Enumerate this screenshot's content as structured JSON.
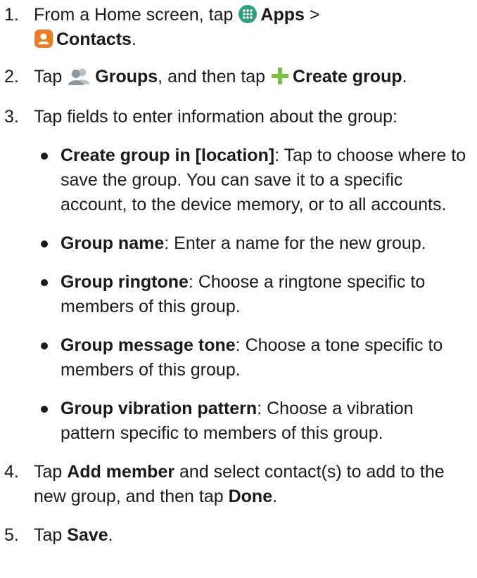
{
  "steps": [
    {
      "number": "1.",
      "before": "From a Home screen, tap ",
      "apps_label": "Apps",
      "separator": " >",
      "contacts_label": "Contacts",
      "after": "."
    },
    {
      "number": "2.",
      "before": "Tap ",
      "groups_label": "Groups",
      "middle": ", and then tap ",
      "create_label": "Create group",
      "after": "."
    },
    {
      "number": "3.",
      "text": "Tap fields to enter information about the group:",
      "fields": [
        {
          "label": "Create group in [location]",
          "desc": ": Tap to choose where to save the group. You can save it to a specific account, to the device memory, or to all accounts."
        },
        {
          "label": "Group name",
          "desc": ": Enter a name for the new group."
        },
        {
          "label": "Group ringtone",
          "desc": ": Choose a ringtone specific to members of this group."
        },
        {
          "label": "Group message tone",
          "desc": ": Choose a tone specific to members of this group."
        },
        {
          "label": "Group vibration pattern",
          "desc": ": Choose a vibration pattern specific to members of this group."
        }
      ]
    },
    {
      "number": "4.",
      "before": "Tap ",
      "add_member_label": "Add member",
      "middle": " and select contact(s) to add to the new group, and then tap ",
      "done_label": "Done",
      "after": "."
    },
    {
      "number": "5.",
      "before": "Tap ",
      "save_label": "Save",
      "after": "."
    }
  ],
  "icons": {
    "apps": "apps-grid-icon",
    "contacts": "contacts-icon",
    "groups": "groups-icon",
    "create": "plus-icon"
  },
  "colors": {
    "apps_icon": "#2f9d80",
    "contacts_icon": "#ef7b23",
    "groups_icon": "#9aa5ad",
    "plus_icon": "#7cc242",
    "text": "#1a1a1a"
  }
}
